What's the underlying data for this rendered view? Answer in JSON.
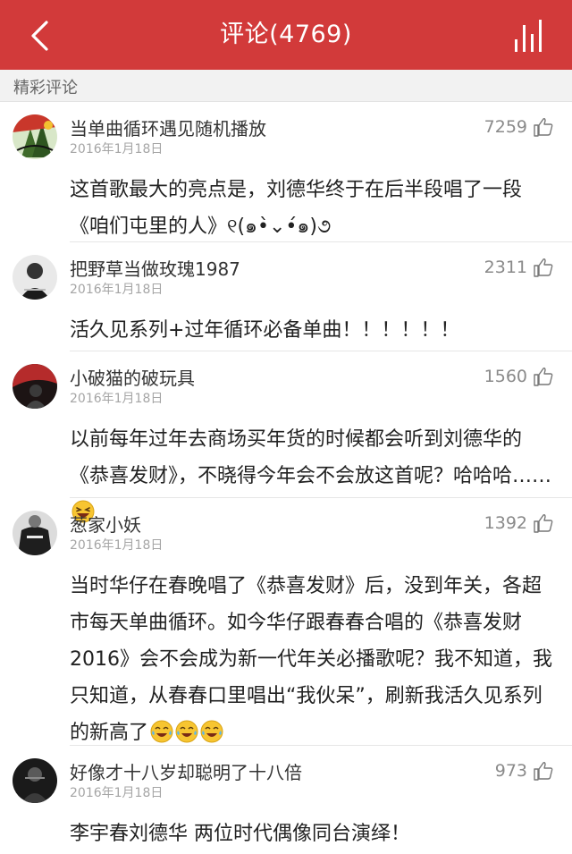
{
  "header": {
    "title": "评论(4769)",
    "back_icon": "chevron-left-icon",
    "stats_icon": "bar-chart-icon",
    "background_color": "#d23a3a"
  },
  "section": {
    "label": "精彩评论"
  },
  "comments": [
    {
      "username": "当单曲循环遇见随机播放",
      "date": "2016年1月18日",
      "likes": "7259",
      "text": "这首歌最大的亮点是，刘德华终于在后半段唱了一段《咱们屯里的人》୧(๑•̀⌄•́๑)૭"
    },
    {
      "username": "把野草当做玫瑰1987",
      "date": "2016年1月18日",
      "likes": "2311",
      "text": "活久见系列+过年循环必备单曲！！！！！！"
    },
    {
      "username": "小破猫的破玩具",
      "date": "2016年1月18日",
      "likes": "1560",
      "text": "以前每年过年去商场买年货的时候都会听到刘德华的《恭喜发财》，不晓得今年会不会放这首呢？哈哈哈……",
      "emoji": [
        "laughing-emoji"
      ]
    },
    {
      "username": "葱家小妖",
      "date": "2016年1月18日",
      "likes": "1392",
      "text": "当时华仔在春晚唱了《恭喜发财》后，没到年关，各超市每天单曲循环。如今华仔跟春春合唱的《恭喜发财2016》会不会成为新一代年关必播歌呢？我不知道，我只知道，从春春口里唱出“我伙呆”，刷新我活久见系列的新高了",
      "emoji": [
        "tears-of-joy-emoji",
        "tears-of-joy-emoji",
        "tears-of-joy-emoji"
      ]
    },
    {
      "username": "好像才十八岁却聪明了十八倍",
      "date": "2016年1月18日",
      "likes": "973",
      "text": "李宇春刘德华 两位时代偶像同台演绎！"
    }
  ]
}
